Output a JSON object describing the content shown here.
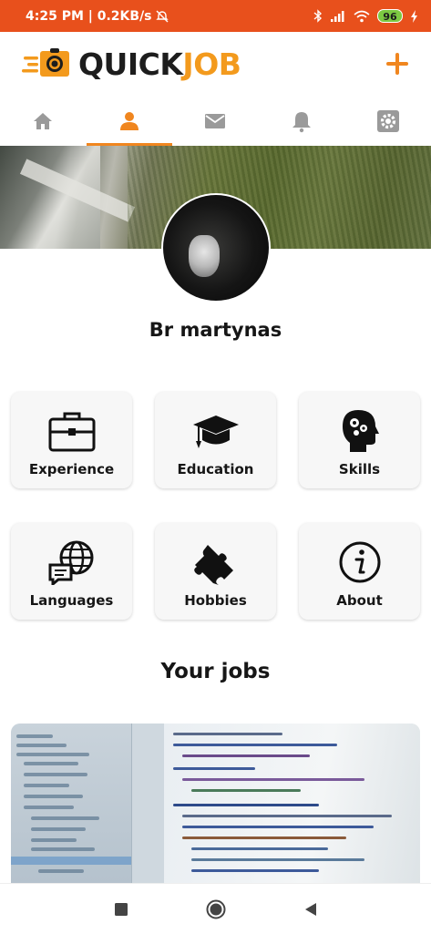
{
  "status_bar": {
    "time": "4:25 PM | 0.2KB/s",
    "battery": "96",
    "icons": [
      "alarm-off-icon",
      "bluetooth-icon",
      "signal-icon",
      "wifi-icon",
      "charging-icon"
    ]
  },
  "header": {
    "logo_quick": "QUICK",
    "logo_job": "JOB",
    "add_icon": "plus-icon"
  },
  "tabs": [
    {
      "icon": "home-icon",
      "active": false
    },
    {
      "icon": "person-icon",
      "active": true
    },
    {
      "icon": "mail-icon",
      "active": false
    },
    {
      "icon": "bell-icon",
      "active": false
    },
    {
      "icon": "gear-icon",
      "active": false
    }
  ],
  "profile": {
    "name": "Br martynas"
  },
  "sections": [
    {
      "label": "Experience",
      "icon": "briefcase-icon"
    },
    {
      "label": "Education",
      "icon": "graduation-cap-icon"
    },
    {
      "label": "Skills",
      "icon": "head-gears-icon"
    },
    {
      "label": "Languages",
      "icon": "globe-chat-icon"
    },
    {
      "label": "Hobbies",
      "icon": "puzzle-icon"
    },
    {
      "label": "About",
      "icon": "info-icon"
    }
  ],
  "jobs": {
    "title": "Your jobs"
  },
  "colors": {
    "status_bar": "#e8501c",
    "accent": "#f0861f",
    "logo_job": "#f39a1d",
    "tab_inactive": "#9a9a9a"
  },
  "navbar": {
    "icons": [
      "recent-apps-icon",
      "home-circle-icon",
      "back-icon"
    ]
  }
}
